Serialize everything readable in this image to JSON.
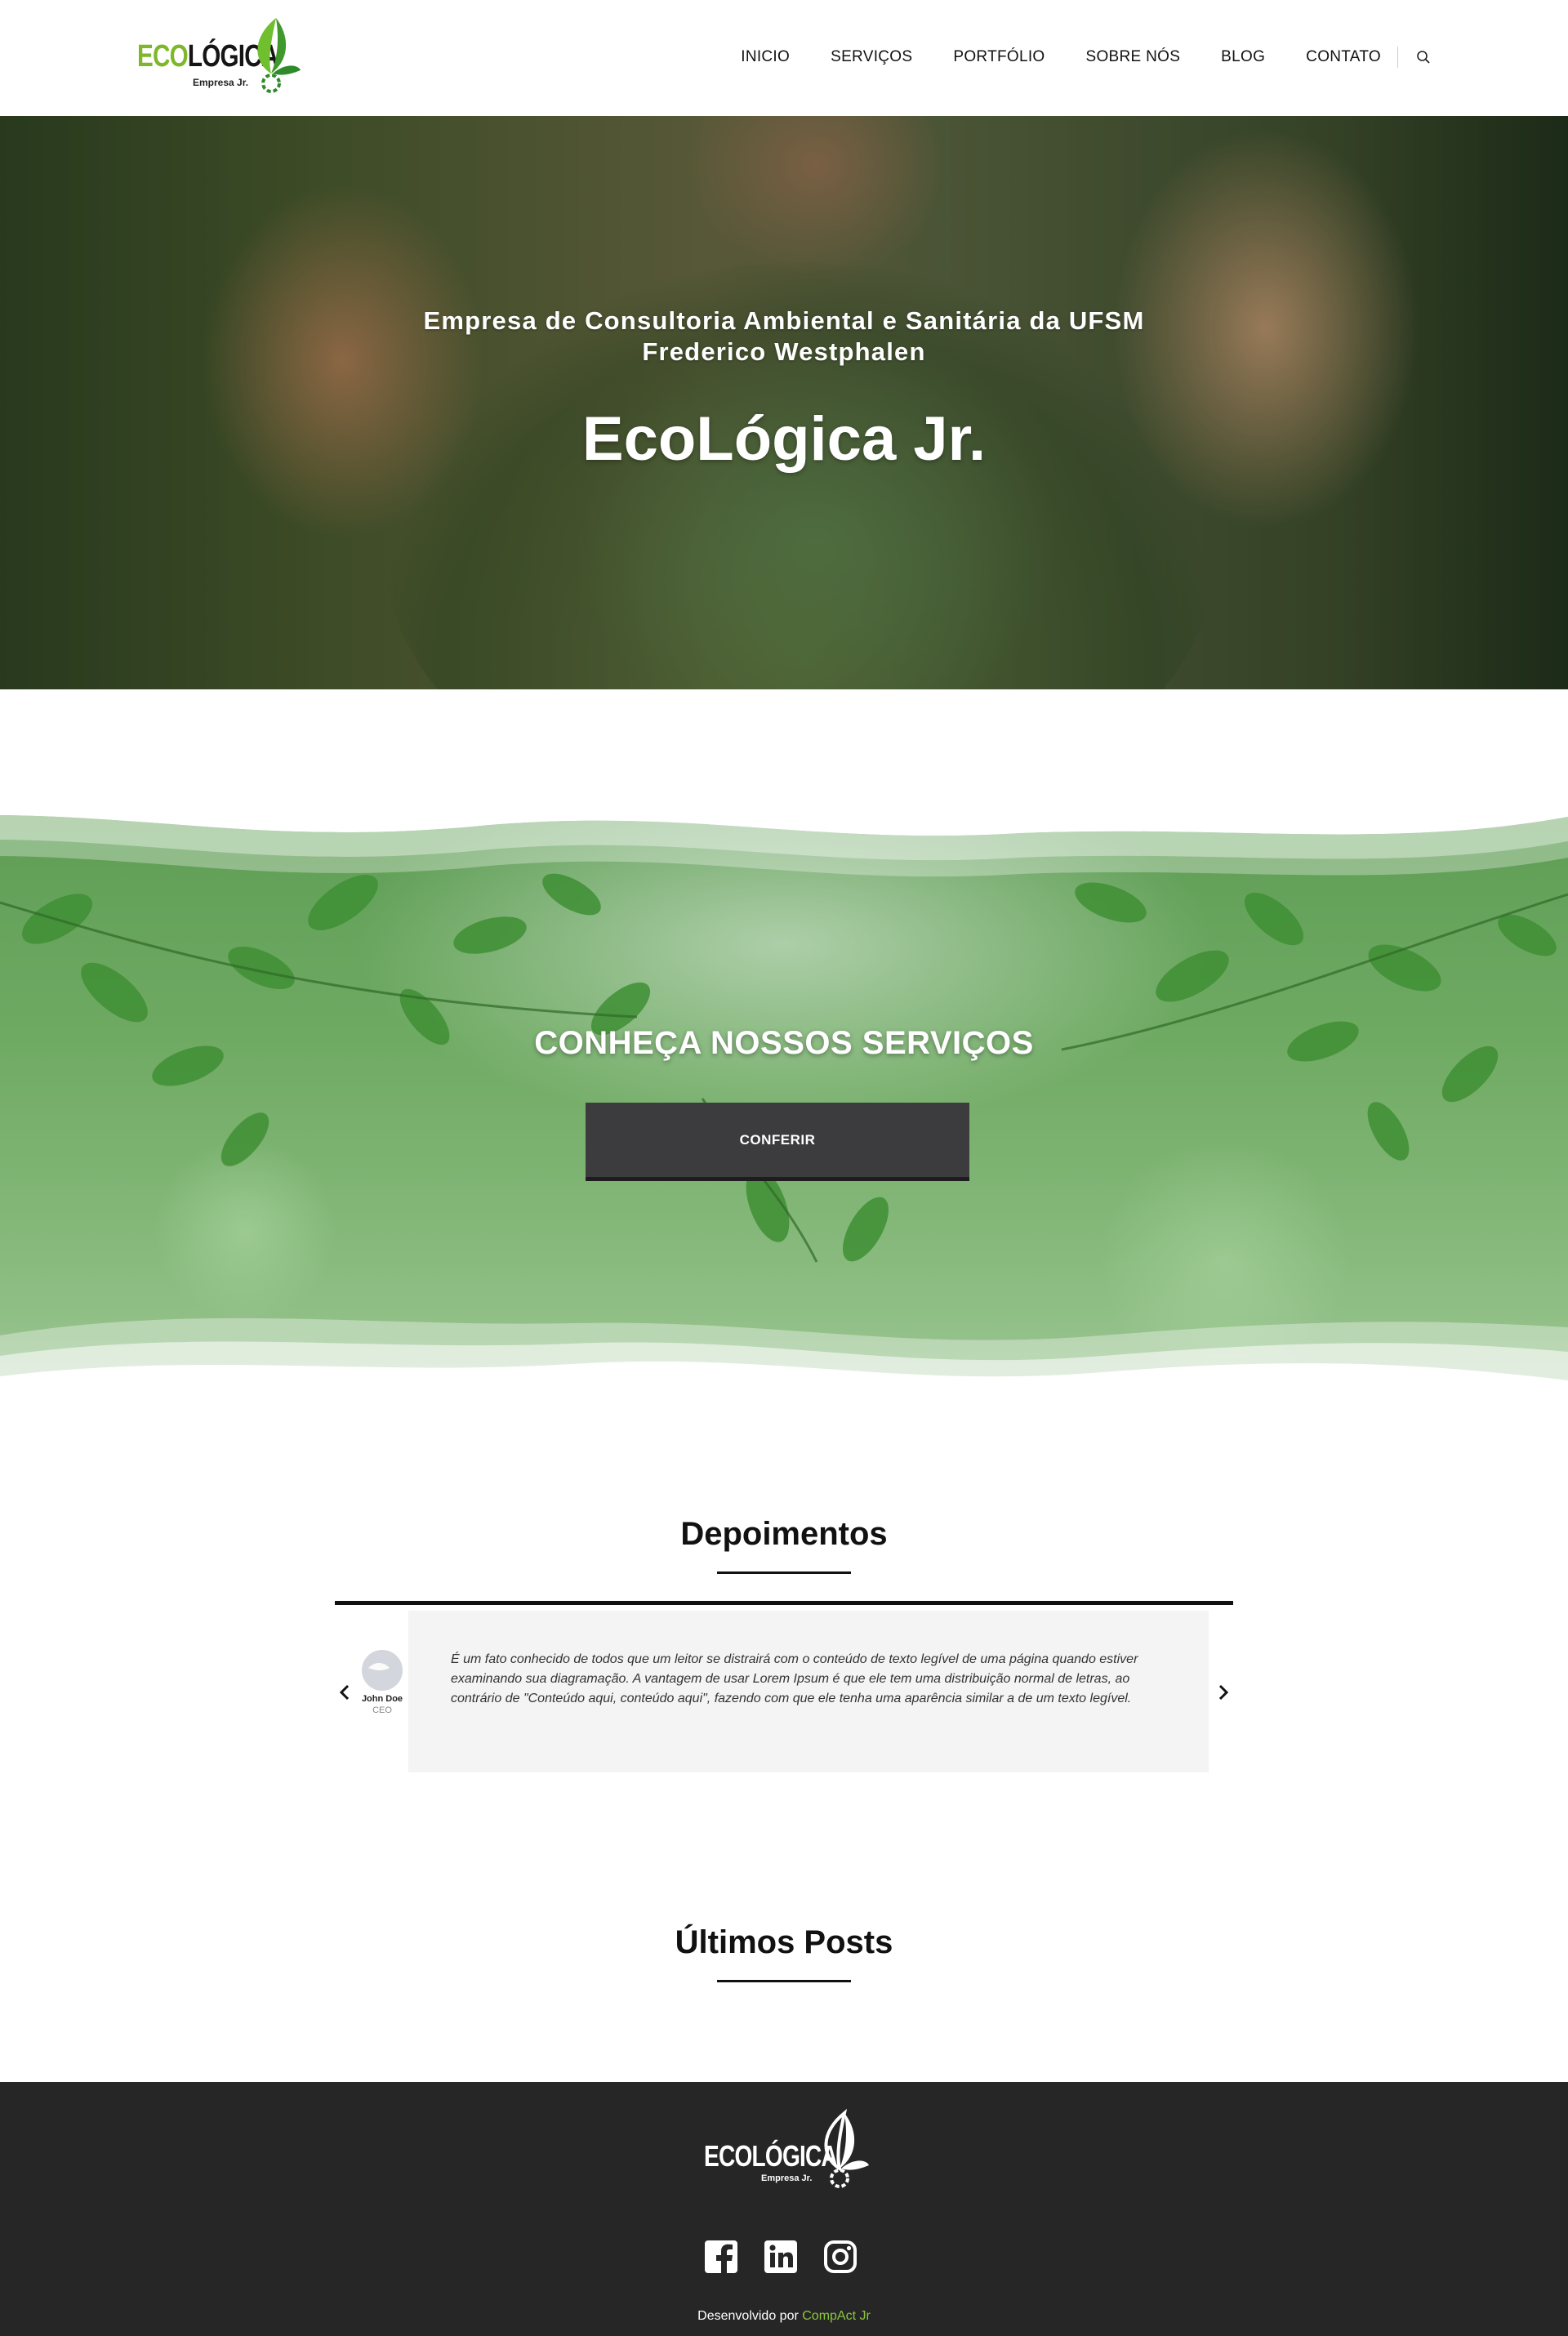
{
  "brand": {
    "logo_word_prefix": "ECO",
    "logo_word_rest": "LÓGICA",
    "logo_sub": "Empresa Jr.",
    "accent": "#7fb72b",
    "dark": "#262626"
  },
  "nav": {
    "items": [
      "INICIO",
      "SERVIÇOS",
      "PORTFÓLIO",
      "SOBRE NÓS",
      "BLOG",
      "CONTATO"
    ],
    "search_icon": "search-icon"
  },
  "hero": {
    "subtitle": "Empresa de Consultoria Ambiental e Sanitária da UFSM Frederico Westphalen",
    "title": "EcoLógica Jr."
  },
  "services": {
    "title": "CONHEÇA NOSSOS SERVIÇOS",
    "button_label": "CONFERIR"
  },
  "testimonials": {
    "heading": "Depoimentos",
    "items": [
      {
        "author": "John Doe",
        "role": "CEO",
        "text": "É um fato conhecido de todos que um leitor se distrairá com o conteúdo de texto legível de uma página quando estiver examinando sua diagramação. A vantagem de usar Lorem Ipsum é que ele tem uma distribuição normal de letras, ao contrário de \"Conteúdo aqui, conteúdo aqui\", fazendo com que ele tenha uma aparência similar a de um texto legível."
      }
    ],
    "prev_icon": "chevron-left-icon",
    "next_icon": "chevron-right-icon"
  },
  "posts": {
    "heading": "Últimos Posts"
  },
  "footer": {
    "logo_word": "ECOLÓGICA",
    "logo_sub": "Empresa Jr.",
    "social": [
      "facebook-icon",
      "linkedin-icon",
      "instagram-icon"
    ],
    "credit_prefix": "Desenvolvido por",
    "credit_link": "CompAct Jr"
  }
}
